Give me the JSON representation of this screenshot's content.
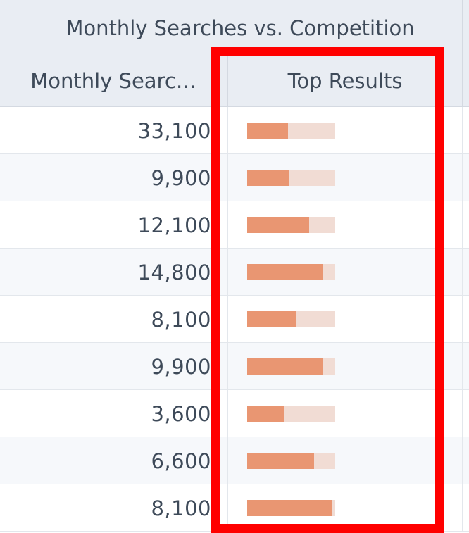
{
  "grid": {
    "group_header": "Monthly Searches vs. Competition",
    "columns": {
      "monthly_searches": "Monthly Searc…",
      "top_results": "Top Results"
    },
    "rows": [
      {
        "monthly_searches": "33,100",
        "top_results_level": 0.46
      },
      {
        "monthly_searches": "9,900",
        "top_results_level": 0.48
      },
      {
        "monthly_searches": "12,100",
        "top_results_level": 0.7
      },
      {
        "monthly_searches": "14,800",
        "top_results_level": 0.86
      },
      {
        "monthly_searches": "8,100",
        "top_results_level": 0.56
      },
      {
        "monthly_searches": "9,900",
        "top_results_level": 0.86
      },
      {
        "monthly_searches": "3,600",
        "top_results_level": 0.42
      },
      {
        "monthly_searches": "6,600",
        "top_results_level": 0.76
      },
      {
        "monthly_searches": "8,100",
        "top_results_level": 0.96
      }
    ]
  },
  "colors": {
    "bar_fill": "#e99672",
    "bar_track": "#f1dcd4",
    "highlight_border": "#ff0000",
    "header_bg": "#e9edf3"
  }
}
